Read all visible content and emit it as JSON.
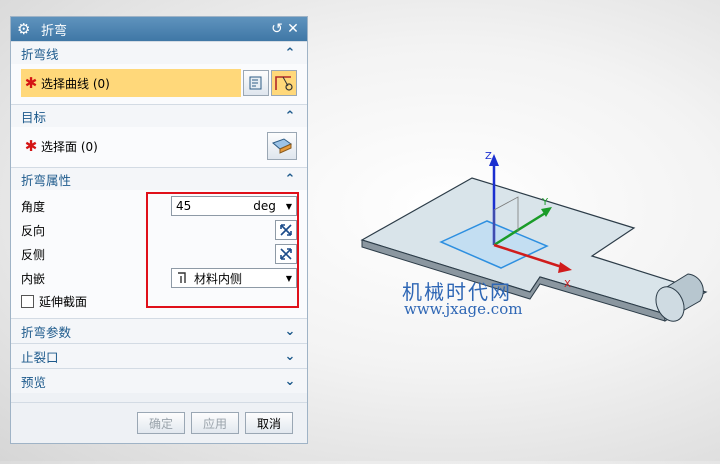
{
  "dialog": {
    "title": "折弯",
    "sections": {
      "bend_line": {
        "header": "折弯线",
        "select_label": "选择曲线 (0)"
      },
      "target": {
        "header": "目标",
        "select_label": "选择面 (0)"
      },
      "bend_props": {
        "header": "折弯属性",
        "angle_label": "角度",
        "angle_value": "45",
        "angle_unit": "deg",
        "reverse_label": "反向",
        "reverse_side_label": "反侧",
        "inset_label": "内嵌",
        "inset_value": "材料内侧",
        "extend_label": "延伸截面"
      },
      "bend_params": {
        "header": "折弯参数"
      },
      "relief": {
        "header": "止裂口"
      },
      "preview": {
        "header": "预览"
      }
    },
    "buttons": {
      "ok": "确定",
      "apply": "应用",
      "cancel": "取消"
    }
  },
  "viewport": {
    "axis_labels": {
      "z": "Z",
      "y": "Y",
      "x": "X"
    },
    "watermark_line1": "机械时代网",
    "watermark_line2": "www.jxage.com"
  },
  "colors": {
    "accent": "#1d5a8c",
    "highlight": "#ffd87a",
    "redbox": "#e0101a"
  }
}
